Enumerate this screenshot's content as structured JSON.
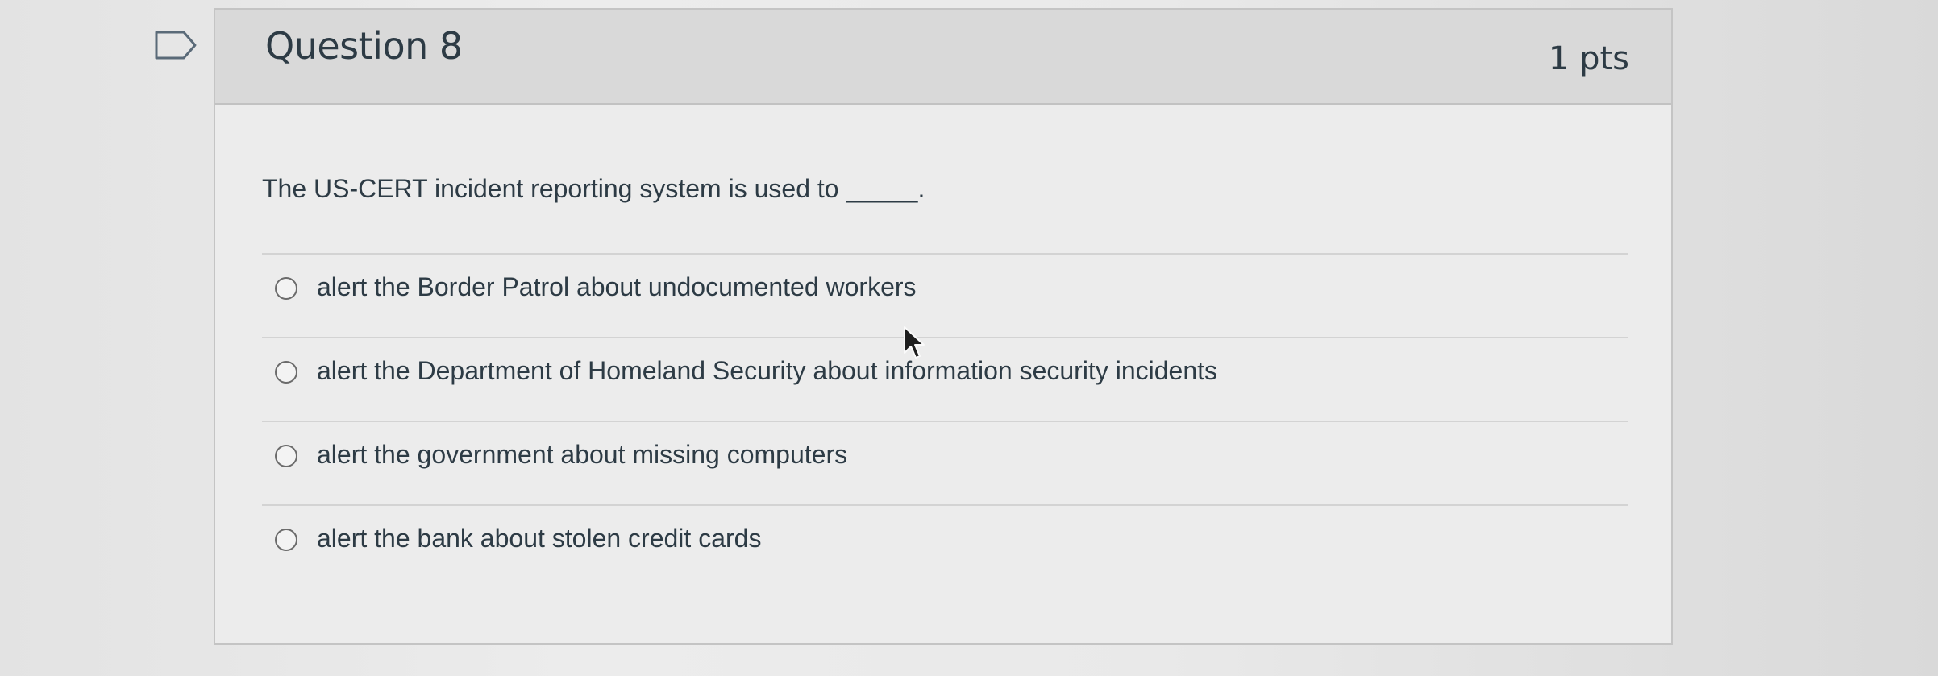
{
  "question": {
    "title": "Question 8",
    "points": "1 pts",
    "text": "The US-CERT incident reporting system is used to _____.",
    "answers": [
      "alert the Border Patrol about undocumented workers",
      "alert the Department of Homeland Security about information security incidents",
      "alert the government about missing computers",
      "alert the bank about stolen credit cards"
    ]
  },
  "icons": {
    "flag": "bookmark-flag-icon",
    "radio": "radio-unchecked-icon",
    "cursor": "mouse-pointer-icon"
  },
  "colors": {
    "header_bg": "#d9d9d9",
    "body_bg": "#ececec",
    "text": "#2d3b45",
    "border": "#c4c4c4"
  }
}
